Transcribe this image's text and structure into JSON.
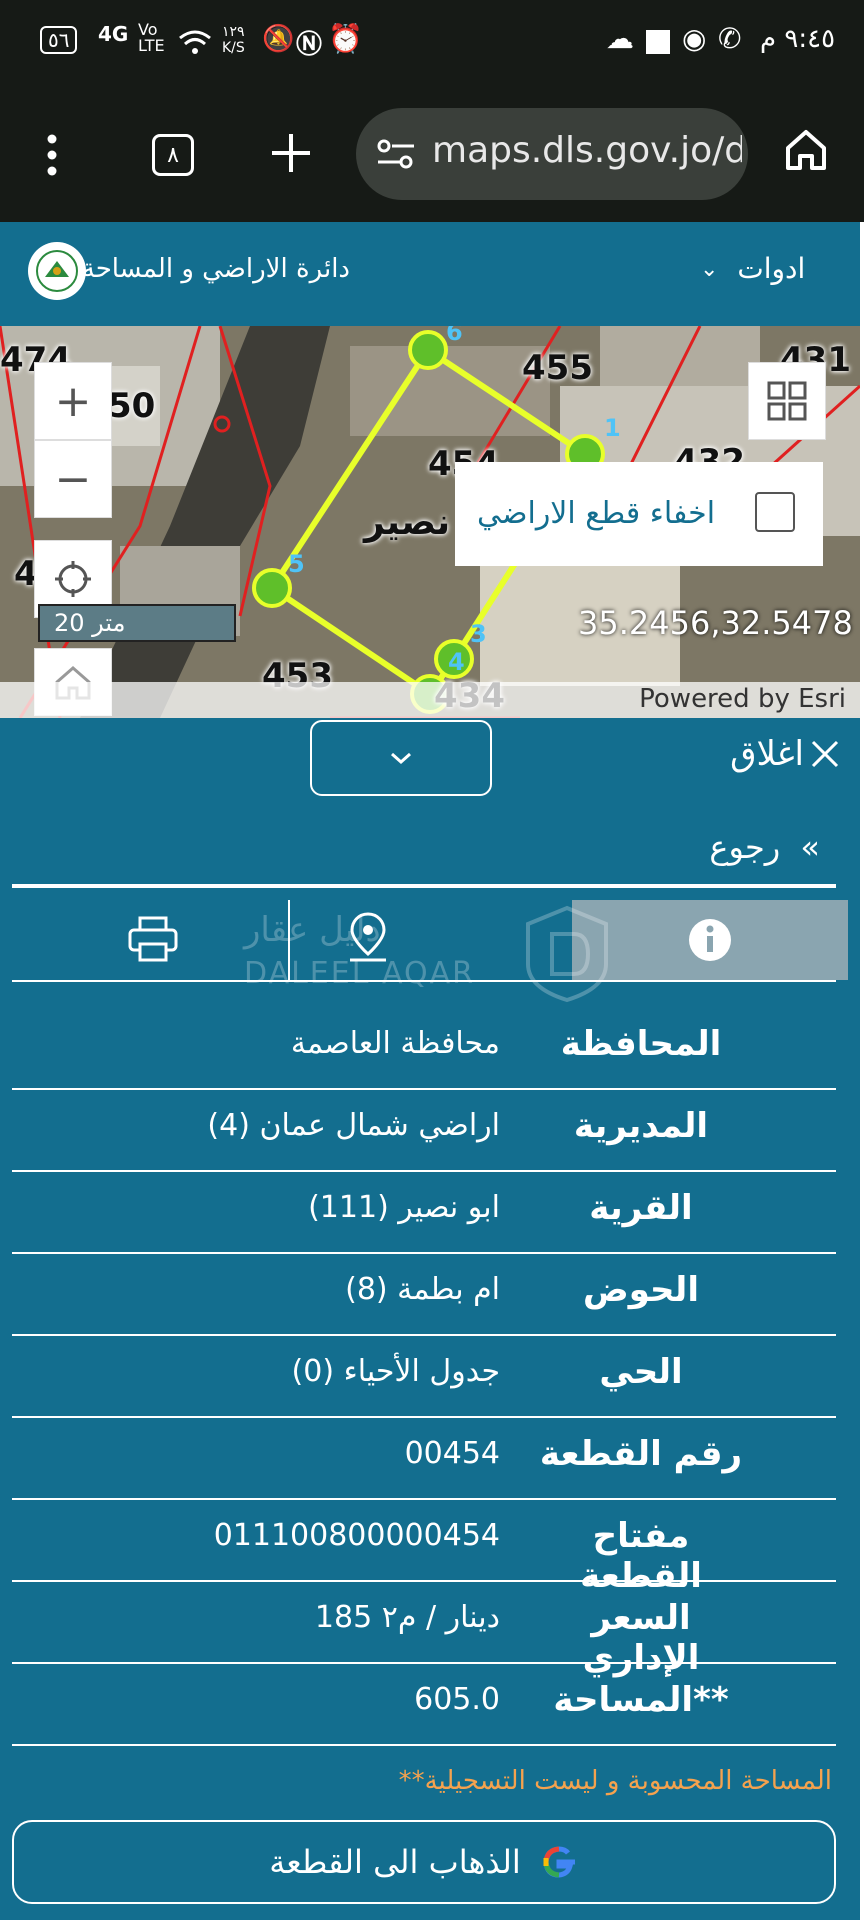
{
  "status_bar": {
    "time": "٩:٤٥ م",
    "battery": "٥٦",
    "network": "4G",
    "volte": "Vo LTE",
    "speed": "١٢٩ K/S"
  },
  "browser": {
    "url": "maps.dls.gov.jo/d",
    "tab_count": "٨"
  },
  "header": {
    "title": "دائرة الاراضي و المساحة",
    "tools_label": "ادوات"
  },
  "map": {
    "parcel_numbers": [
      "474",
      "50",
      "455",
      "454",
      "431",
      "432",
      "453",
      "434",
      "4"
    ],
    "village_label": "نصير",
    "vertex_labels": [
      "6",
      "1",
      "5",
      "3",
      "4"
    ],
    "scale_label": "20 متر",
    "hide_parcels_label": "اخفاء قطع الاراضي",
    "coordinates": "35.2456,32.5478",
    "attribution": "Powered by Esri"
  },
  "panel": {
    "close_label": "اغلاق",
    "back_label": "رجوع",
    "watermark_ar": "دليل عقار",
    "watermark_en": "DALEEL AQAR",
    "rows": [
      {
        "key": "المحافظة",
        "value": "محافظة العاصمة"
      },
      {
        "key": "المديرية",
        "value": "اراضي شمال عمان (4)"
      },
      {
        "key": "القرية",
        "value": "ابو نصير (111)"
      },
      {
        "key": "الحوض",
        "value": "ام بطمة (8)"
      },
      {
        "key": "الحي",
        "value": "جدول الأحياء (0)"
      },
      {
        "key": "رقم القطعة",
        "value": "00454"
      },
      {
        "key": "مفتاح القطعة",
        "value": "011100800000454"
      },
      {
        "key": "السعر الإداري",
        "value": "185 دينار / م٢"
      },
      {
        "key": "المساحة**",
        "value": "605.0"
      }
    ],
    "note": "**المساحة المحسوبة و ليست التسجيلية",
    "go_button": "الذهاب الى القطعة"
  },
  "colors": {
    "primary": "#136e8f",
    "note": "#f5a24e",
    "parcel_line": "#e8ff2a",
    "boundary": "#e02020"
  }
}
